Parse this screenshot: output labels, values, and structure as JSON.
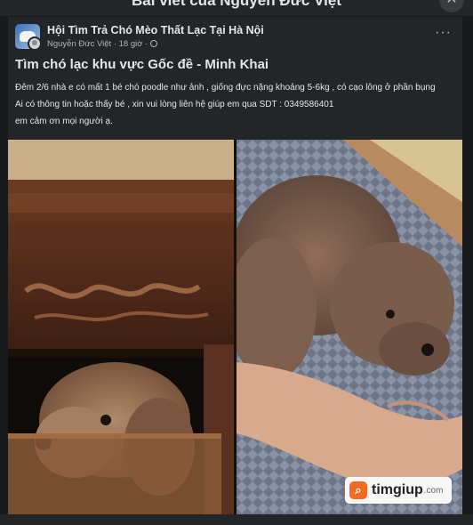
{
  "dialog": {
    "title": "Bài viết của Nguyễn Đức Việt",
    "close_icon": "close-icon"
  },
  "post": {
    "group_name": "Hội Tìm Trả Chó Mèo Thất Lạc Tại Hà Nội",
    "author": "Nguyễn Đức Việt",
    "time": "· 18 giờ ·",
    "title": "Tìm chó lạc khu vực Gốc đề - Minh Khai",
    "body": [
      "Đêm 2/6 nhà e có mất 1 bé chó poodle như ảnh , giống đực nặng khoảng 5-6kg , có cạo lông ở phần bụng",
      "Ai có thông tin hoặc thấy bé , xin vui lòng liên hệ giúp em qua SDT : 0349586401",
      "em cảm ơn mọi người ạ."
    ]
  },
  "watermark": {
    "brand": "timgiup",
    "domain": ".com"
  },
  "colors": {
    "background": "#18191a",
    "card": "#242526",
    "text": "#e4e6eb",
    "muted": "#b0b3b8",
    "brand_orange": "#f36b21"
  }
}
